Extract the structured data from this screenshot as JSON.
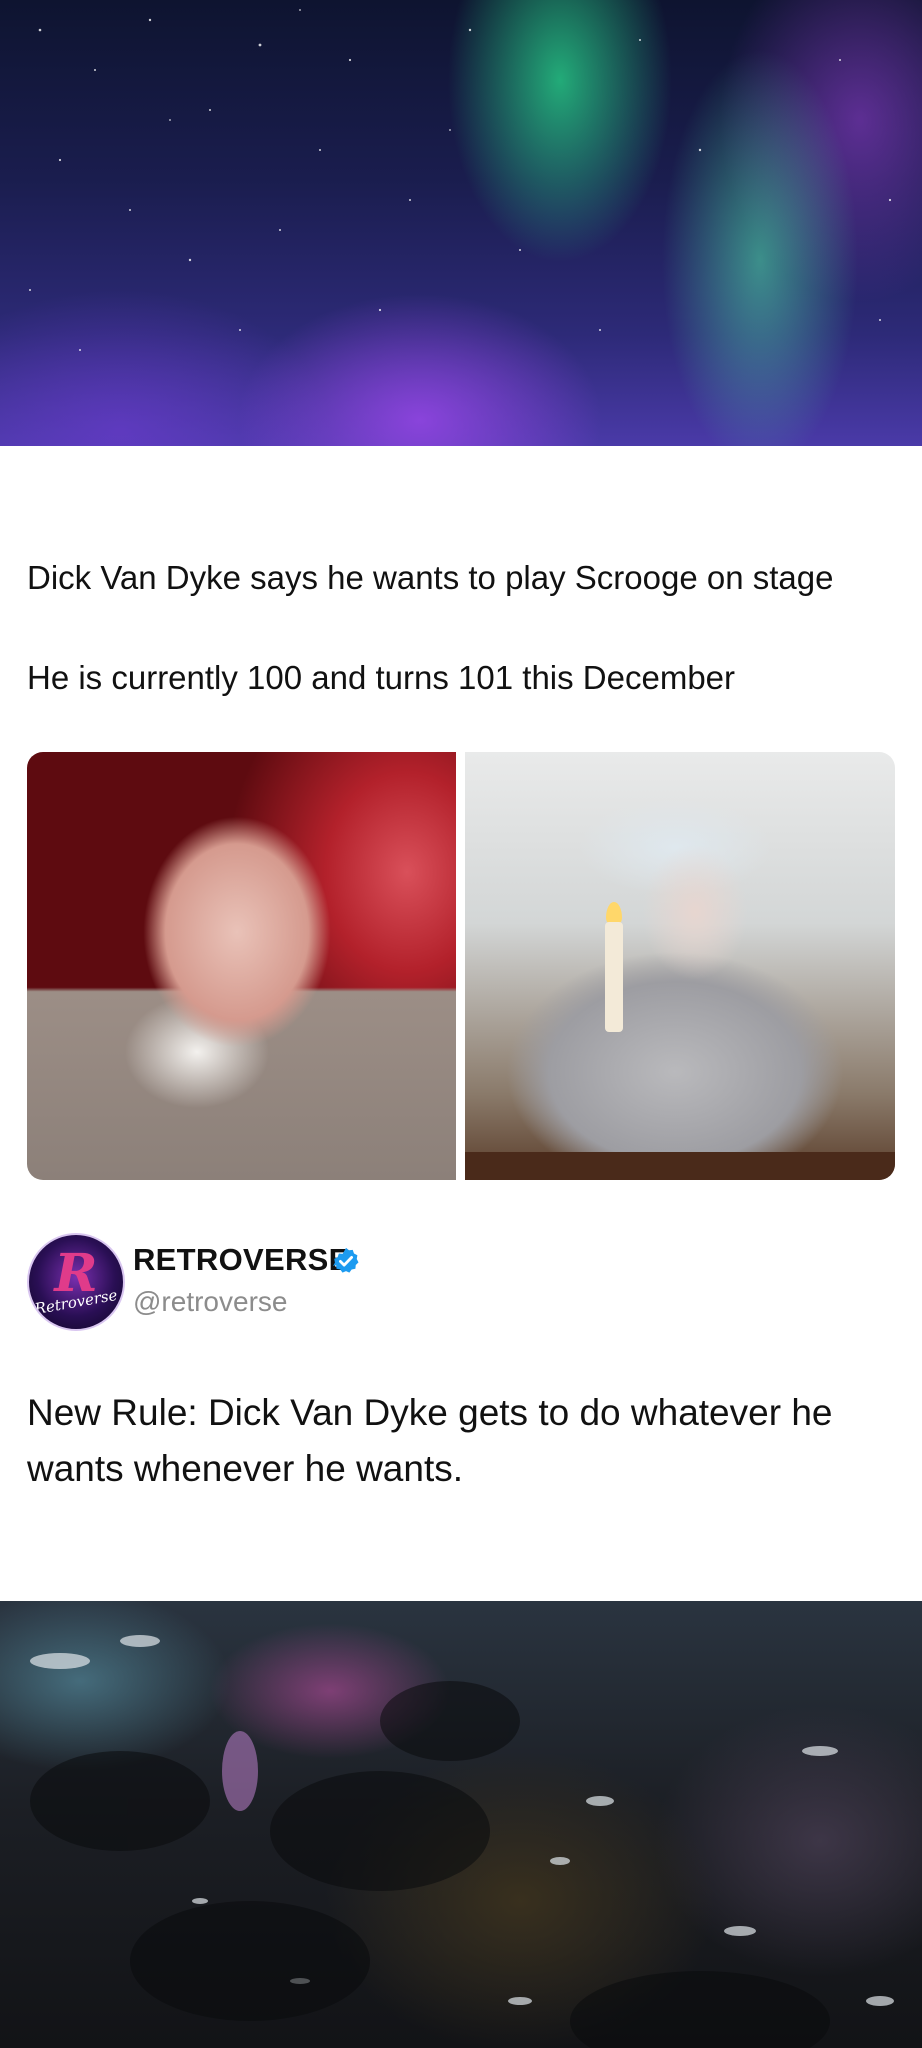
{
  "post": {
    "line1": "Dick Van Dyke says he wants to play Scrooge on stage",
    "line2": "He is currently 100 and turns 101 this December"
  },
  "tweet": {
    "display_name": "RETROVERSE",
    "handle": "@retroverse",
    "verified": true,
    "avatar_letter": "R",
    "avatar_word": "Retroverse",
    "text": "New Rule: Dick Van Dyke gets to do whatever he wants whenever he wants."
  },
  "colors": {
    "verified_badge": "#1d9bf0",
    "text": "#111111",
    "handle": "#8c8c8c"
  },
  "icons": {
    "verified": "verified-badge-icon"
  }
}
